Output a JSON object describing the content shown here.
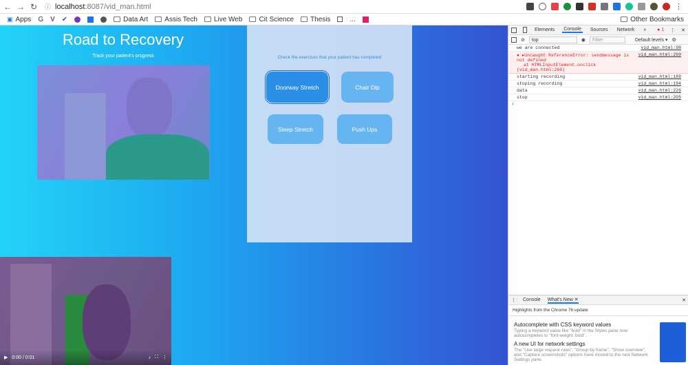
{
  "browser": {
    "url_host": "localhost",
    "url_path": ":8087/vid_man.html",
    "bookmarks": [
      "Apps",
      "G",
      "Data Art",
      "Assis Tech",
      "Live Web",
      "Cit Science",
      "Thesis",
      "...",
      "Other Bookmarks"
    ]
  },
  "page": {
    "title": "Road to Recovery",
    "subtitle": "Track your patient's progress",
    "panel_text": "Check the exercises that your patient has completed",
    "exercises": [
      "Doorway Stretch",
      "Chair Dip",
      "Sleep Stretch",
      "Push Ups"
    ],
    "video_time": "0:00 / 0:01"
  },
  "devtools": {
    "tabs": [
      "Elements",
      "Console",
      "Sources",
      "Network",
      "»"
    ],
    "error_count": "1",
    "context": "top",
    "filter_placeholder": "Filter",
    "levels": "Default levels",
    "log": [
      {
        "msg": "we are connected",
        "src": "vid_man.html:98"
      },
      {
        "msg": "▸Uncaught ReferenceError: sendmessage is not defined",
        "msg2": "at HTMLInputElement.onclick (vid_man.html:269)",
        "src": "vid_man.html:269"
      },
      {
        "msg": "starting recording",
        "src": "vid_man.html:188"
      },
      {
        "msg": "stoping recording",
        "src": "vid_man.html:194"
      },
      {
        "msg": "data",
        "src": "vid_man.html:226"
      },
      {
        "msg": "stop",
        "src": "vid_man.html:205"
      }
    ],
    "drawer_tabs": [
      "Console",
      "What's New"
    ],
    "drawer_sub": "Highlights from the Chrome 76 update",
    "whats_new": [
      {
        "head": "Autocomplete with CSS keyword values",
        "body": "Typing a keyword value like \"bold\" in the Styles pane now autocompletes to \"font-weight: bold\"."
      },
      {
        "head": "A new UI for network settings",
        "body": "The \"Use large request rows\", \"Group by frame\", \"Show overview\", and \"Capture screenshots\" options have moved to the new Network Settings pane."
      }
    ]
  }
}
